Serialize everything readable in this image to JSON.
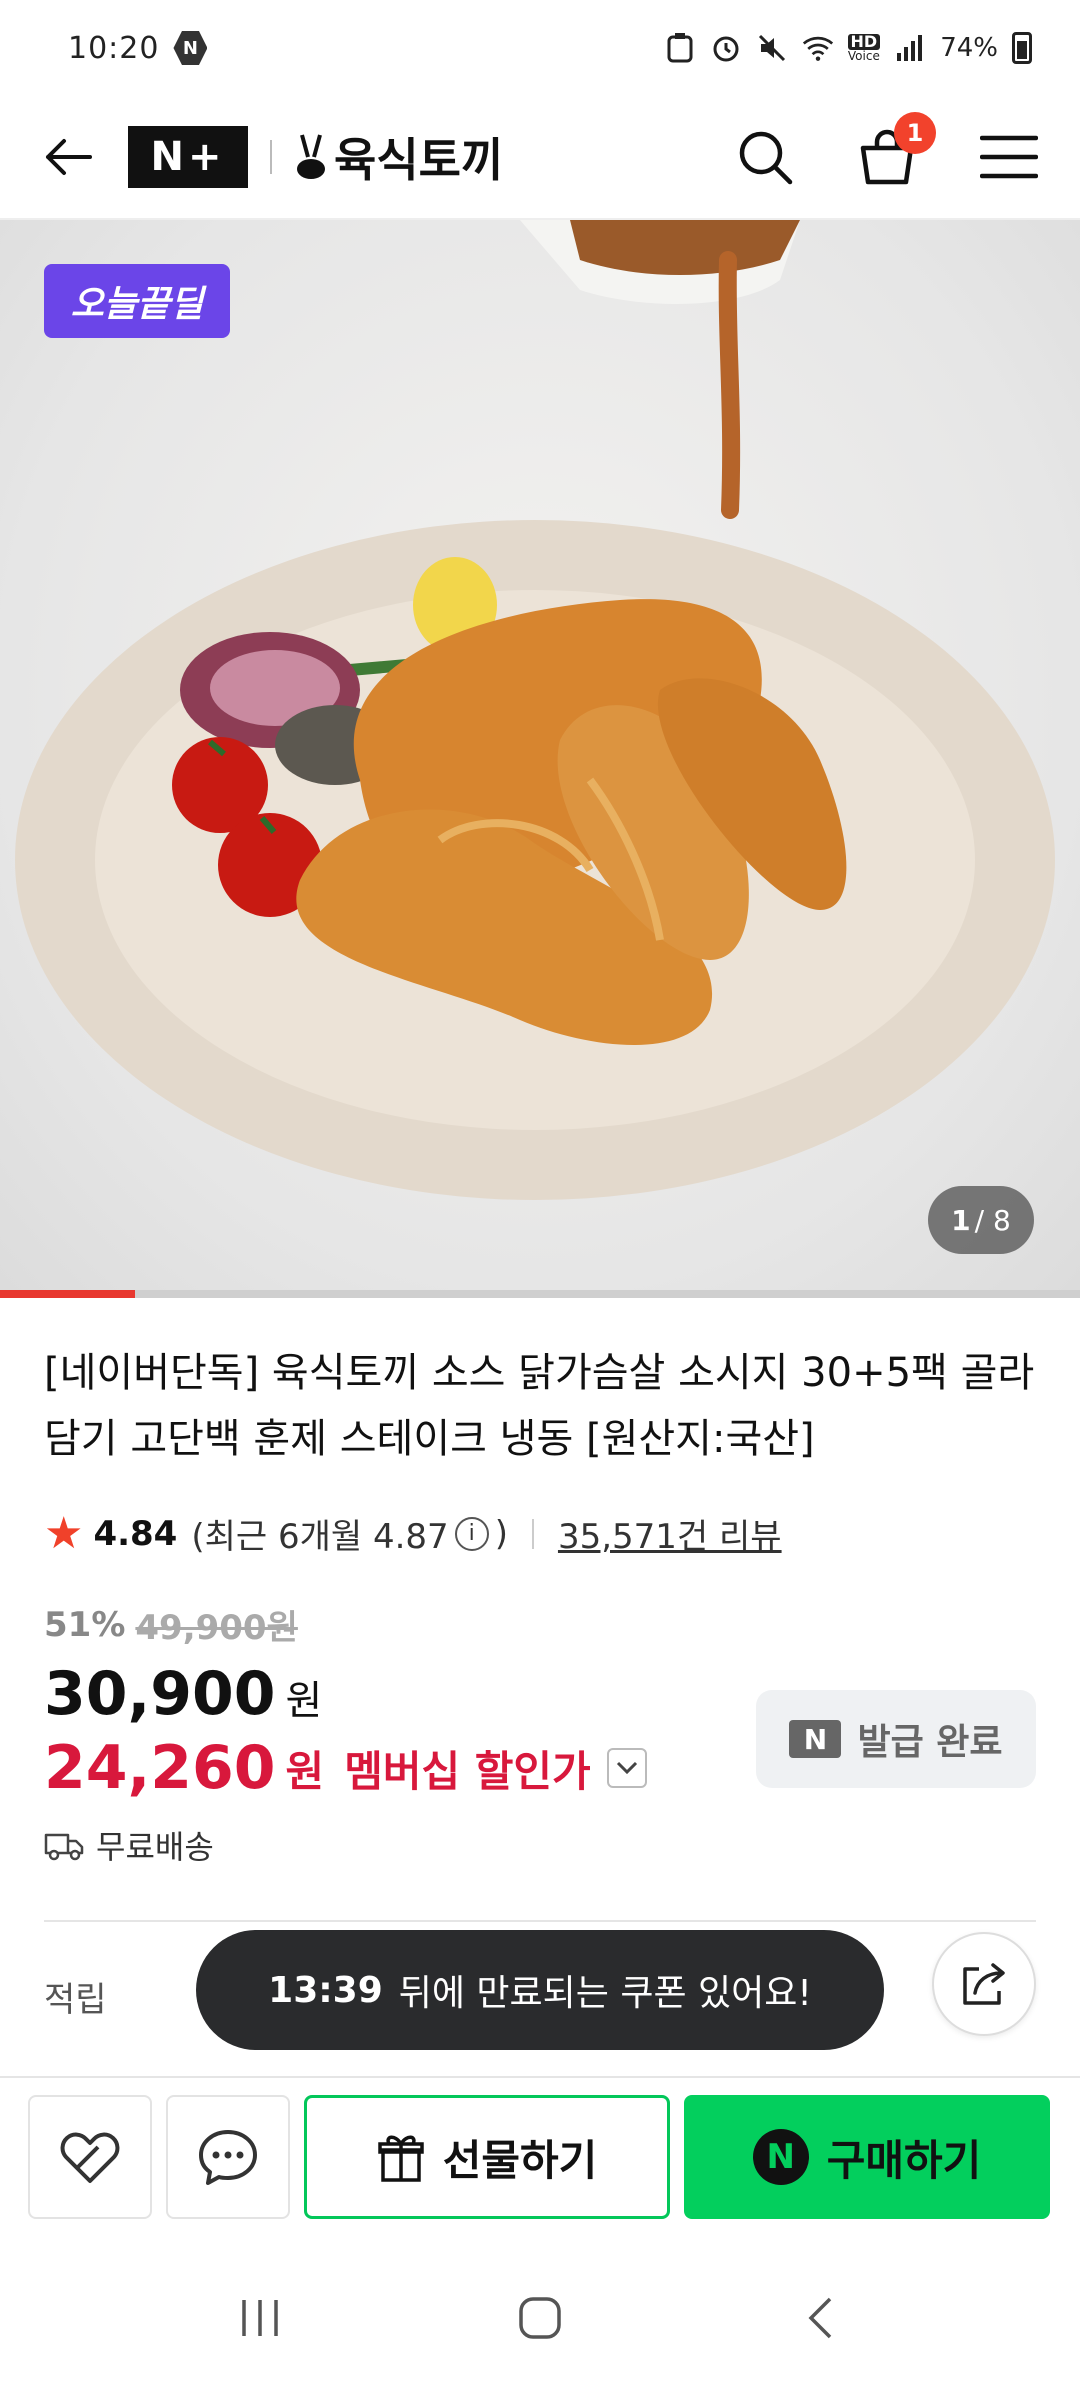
{
  "status_bar": {
    "time": "10:20",
    "battery": "74%",
    "carrier_icon": "N",
    "hd_label": "HD",
    "voice_label": "Voice"
  },
  "header": {
    "brand_badge": "N+",
    "brand_name": "육식토끼",
    "cart_count": "1"
  },
  "hero": {
    "badge": "오늘끝딜",
    "page_current": "1",
    "page_total": "/ 8",
    "progress_fraction": 0.125
  },
  "product": {
    "title": "[네이버단독] 육식토끼 소스 닭가슴살 소시지 30+5팩 골라담기 고단백 훈제 스테이크 냉동 [원산지:국산]",
    "rating": "4.84",
    "recent_open": "(최근 6개월 4.87",
    "recent_close": ")",
    "info_glyph": "i",
    "reviews": "35,571건 리뷰",
    "discount_rate": "51%",
    "original_price": "49,900원",
    "price": "30,900",
    "price_unit": "원",
    "member_price": "24,260",
    "member_unit": "원",
    "member_label": "멤버십 할인가",
    "coupon_badge": "N",
    "coupon_label": "발급 완료",
    "shipping": "무료배송",
    "points_label": "적립"
  },
  "toast": {
    "time": "13:39",
    "message": "뒤에 만료되는 쿠폰 있어요!"
  },
  "actions": {
    "gift_label": "선물하기",
    "buy_label": "구매하기",
    "buy_logo": "N"
  },
  "colors": {
    "accent_green": "#03cf5d",
    "member_red": "#d8183c",
    "badge_purple": "#6b45e8",
    "progress_red": "#e8382f"
  }
}
